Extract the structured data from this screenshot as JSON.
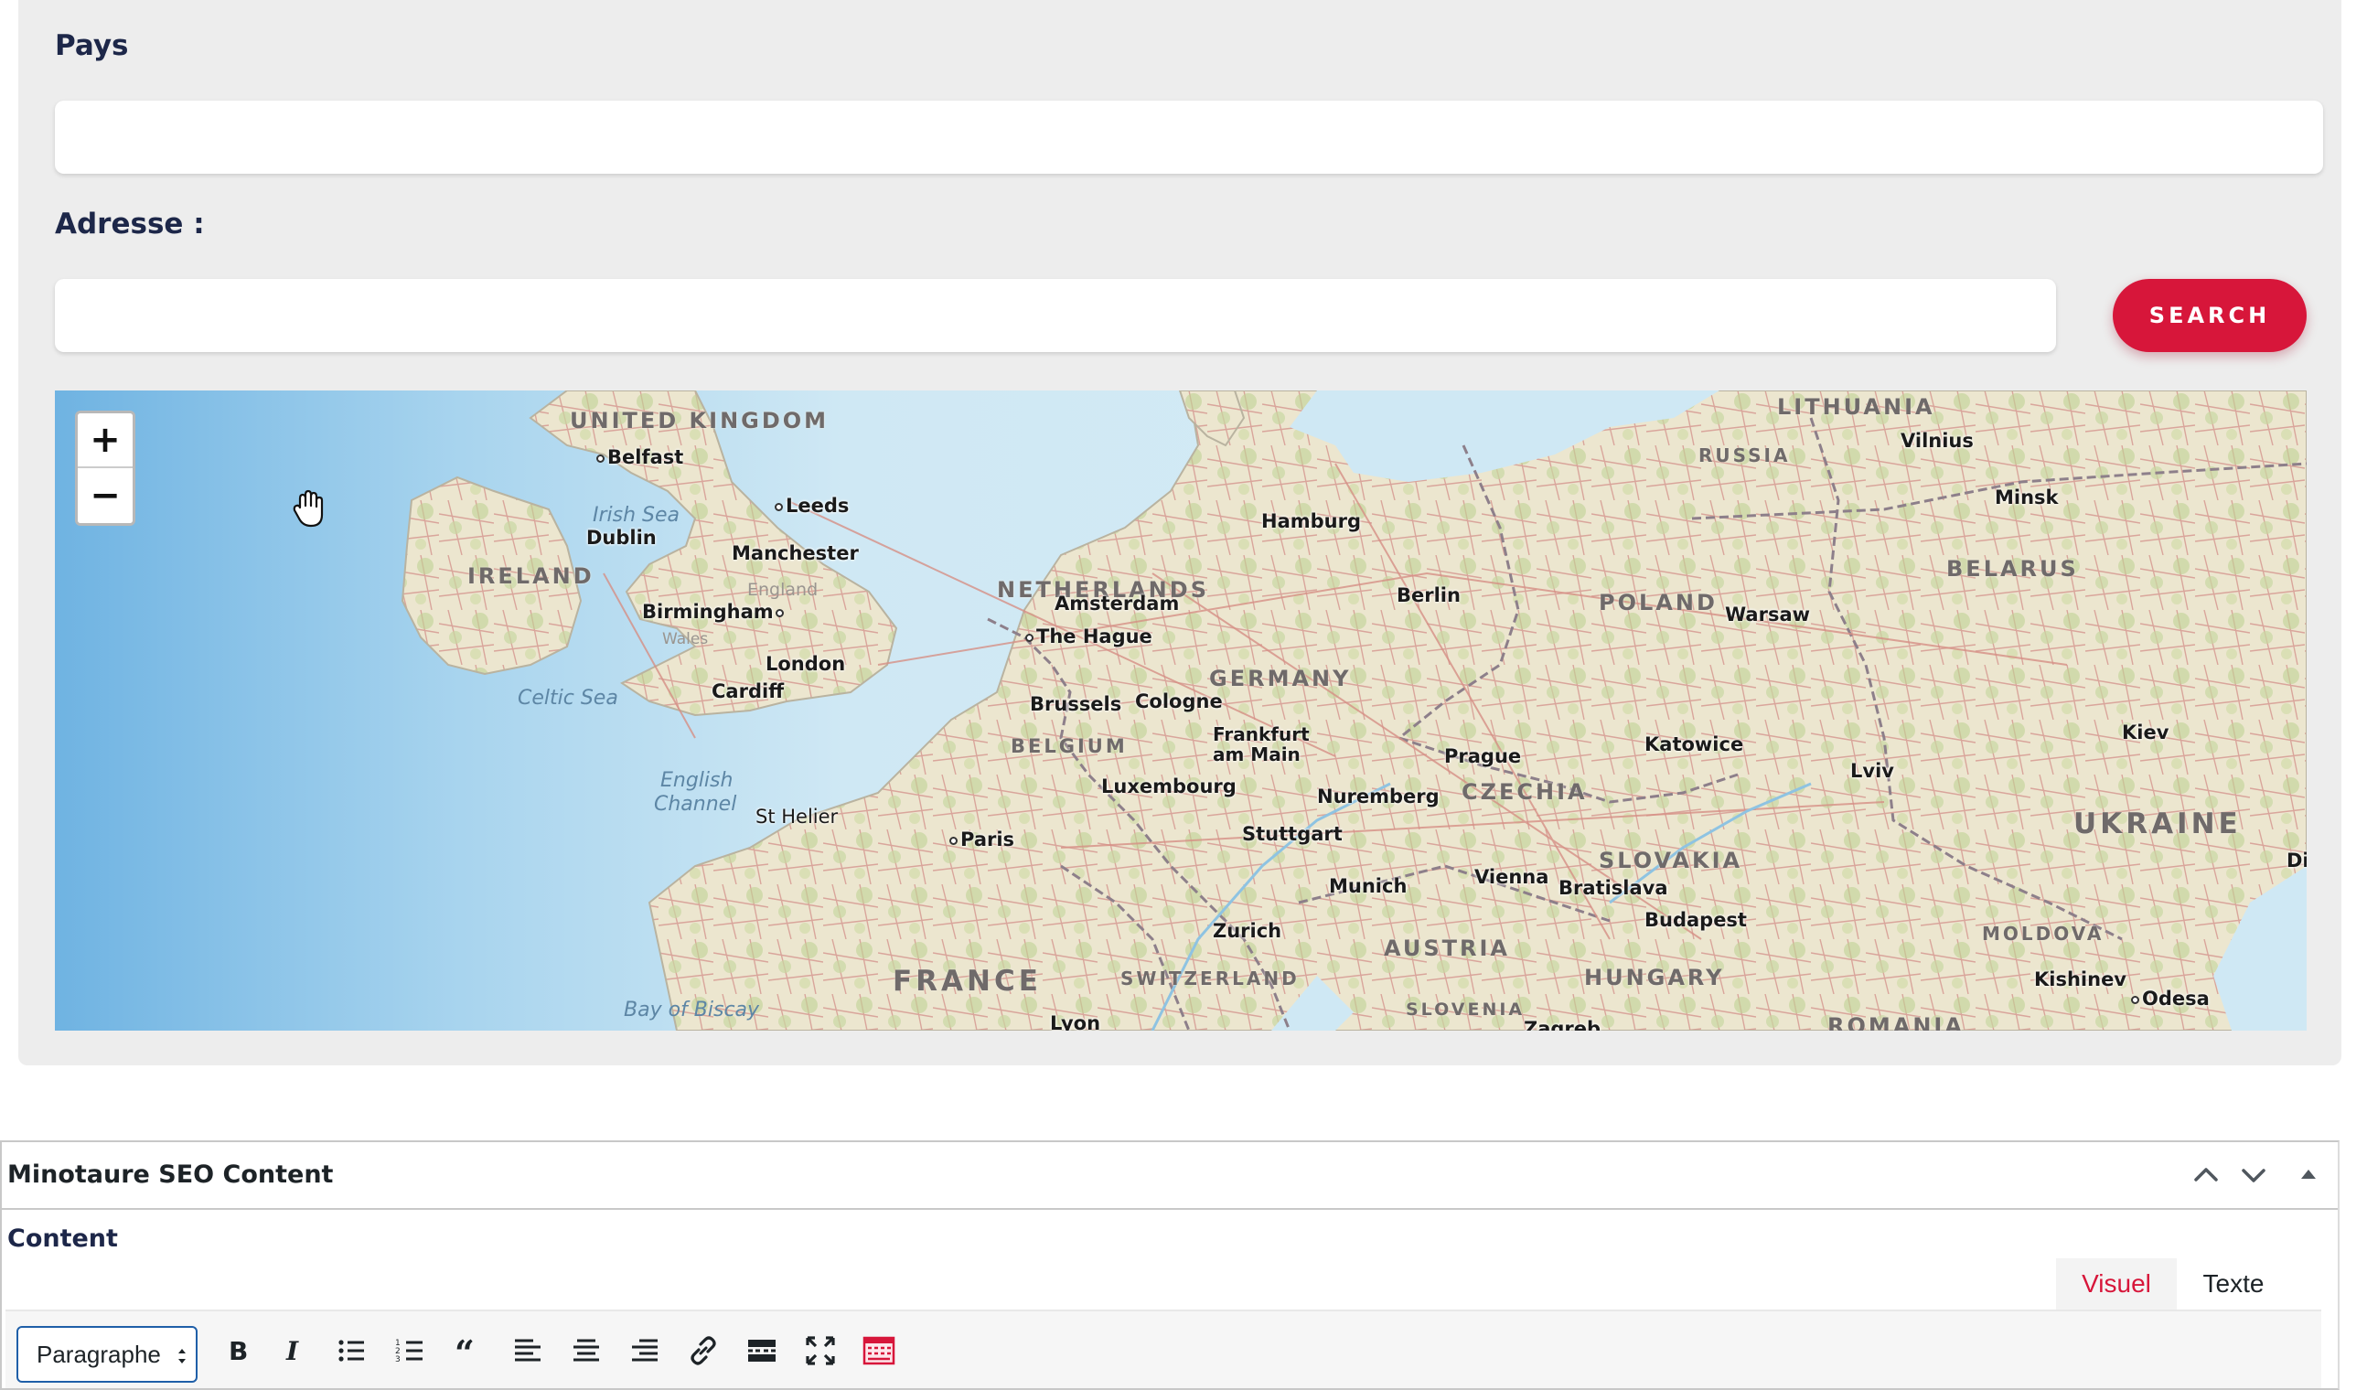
{
  "form": {
    "country_label": "Pays",
    "country_value": "",
    "address_label": "Adresse :",
    "address_value": "",
    "search_label": "SEARCH"
  },
  "map": {
    "zoom_in": "+",
    "zoom_out": "−",
    "countries": [
      {
        "id": "uk",
        "text": "UNITED KINGDOM"
      },
      {
        "id": "ireland",
        "text": "IRELAND"
      },
      {
        "id": "netherlands",
        "text": "NETHERLANDS"
      },
      {
        "id": "belgium",
        "text": "BELGIUM"
      },
      {
        "id": "germany",
        "text": "GERMANY"
      },
      {
        "id": "poland",
        "text": "POLAND"
      },
      {
        "id": "czechia",
        "text": "CZECHIA"
      },
      {
        "id": "slovakia",
        "text": "SLOVAKIA"
      },
      {
        "id": "austria",
        "text": "AUSTRIA"
      },
      {
        "id": "hungary",
        "text": "HUNGARY"
      },
      {
        "id": "switzerland",
        "text": "SWITZERLAND"
      },
      {
        "id": "slovenia",
        "text": "SLOVENIA"
      },
      {
        "id": "france",
        "text": "FRANCE"
      },
      {
        "id": "ukraine",
        "text": "UKRAINE"
      },
      {
        "id": "belarus",
        "text": "BELARUS"
      },
      {
        "id": "lithuania",
        "text": "LITHUANIA"
      },
      {
        "id": "russia",
        "text": "RUSSIA"
      },
      {
        "id": "moldova",
        "text": "MOLDOVA"
      },
      {
        "id": "romania",
        "text": "ROMANIA"
      }
    ],
    "seas": [
      {
        "id": "irish-sea",
        "text": "Irish Sea"
      },
      {
        "id": "celtic-sea",
        "text": "Celtic Sea"
      },
      {
        "id": "english-channel-1",
        "text": "English"
      },
      {
        "id": "english-channel-2",
        "text": "Channel"
      },
      {
        "id": "bay-of-biscay",
        "text": "Bay of Biscay"
      }
    ],
    "regions": [
      {
        "id": "england",
        "text": "England"
      },
      {
        "id": "wales",
        "text": "Wales"
      }
    ],
    "cities": [
      {
        "id": "belfast",
        "text": "Belfast"
      },
      {
        "id": "leeds",
        "text": "Leeds"
      },
      {
        "id": "dublin",
        "text": "Dublin"
      },
      {
        "id": "manchester",
        "text": "Manchester"
      },
      {
        "id": "birmingham",
        "text": "Birmingham"
      },
      {
        "id": "london",
        "text": "London"
      },
      {
        "id": "cardiff",
        "text": "Cardiff"
      },
      {
        "id": "st-helier",
        "text": "St Helier"
      },
      {
        "id": "paris",
        "text": "Paris"
      },
      {
        "id": "amsterdam",
        "text": "Amsterdam"
      },
      {
        "id": "the-hague",
        "text": "The Hague"
      },
      {
        "id": "brussels",
        "text": "Brussels"
      },
      {
        "id": "cologne",
        "text": "Cologne"
      },
      {
        "id": "luxembourg",
        "text": "Luxembourg"
      },
      {
        "id": "frankfurt-1",
        "text": "Frankfurt"
      },
      {
        "id": "frankfurt-2",
        "text": "am Main"
      },
      {
        "id": "hamburg",
        "text": "Hamburg"
      },
      {
        "id": "berlin",
        "text": "Berlin"
      },
      {
        "id": "nuremberg",
        "text": "Nuremberg"
      },
      {
        "id": "stuttgart",
        "text": "Stuttgart"
      },
      {
        "id": "munich",
        "text": "Munich"
      },
      {
        "id": "zurich",
        "text": "Zurich"
      },
      {
        "id": "prague",
        "text": "Prague"
      },
      {
        "id": "vienna",
        "text": "Vienna"
      },
      {
        "id": "bratislava",
        "text": "Bratislava"
      },
      {
        "id": "budapest",
        "text": "Budapest"
      },
      {
        "id": "warsaw",
        "text": "Warsaw"
      },
      {
        "id": "katowice",
        "text": "Katowice"
      },
      {
        "id": "lviv",
        "text": "Lviv"
      },
      {
        "id": "kiev",
        "text": "Kiev"
      },
      {
        "id": "minsk",
        "text": "Minsk"
      },
      {
        "id": "vilnius",
        "text": "Vilnius"
      },
      {
        "id": "kishinev",
        "text": "Kishinev"
      },
      {
        "id": "odesa",
        "text": "Odesa"
      },
      {
        "id": "lyon",
        "text": "Lyon"
      },
      {
        "id": "zagreb",
        "text": "Zagreb"
      },
      {
        "id": "dnipro",
        "text": "Di"
      }
    ]
  },
  "metabox": {
    "title": "Minotaure SEO Content",
    "content_label": "Content",
    "tab_visual": "Visuel",
    "tab_text": "Texte",
    "format_select": "Paragraphe",
    "toolbar_icons": [
      "bold-icon",
      "italic-icon",
      "bullet-list-icon",
      "numbered-list-icon",
      "blockquote-icon",
      "align-left-icon",
      "align-center-icon",
      "align-right-icon",
      "link-icon",
      "read-more-icon",
      "fullscreen-icon",
      "toolbar-toggle-icon"
    ],
    "accent_color": "#d7163a"
  }
}
